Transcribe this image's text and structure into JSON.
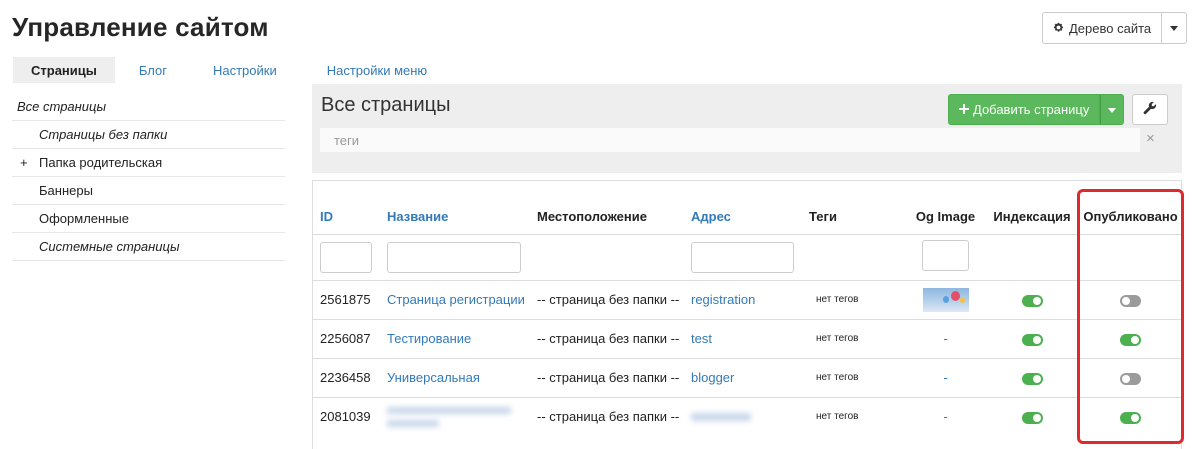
{
  "page": {
    "title": "Управление сайтом"
  },
  "header": {
    "site_tree_label": "Дерево сайта"
  },
  "tabs": [
    {
      "label": "Страницы",
      "active": true
    },
    {
      "label": "Блог"
    },
    {
      "label": "Настройки"
    },
    {
      "label": "Настройки меню"
    }
  ],
  "sidebar": {
    "items": [
      {
        "label": "Все страницы"
      },
      {
        "label": "Страницы без папки"
      },
      {
        "label": "Папка родительская",
        "expander": "+"
      },
      {
        "label": "Баннеры"
      },
      {
        "label": "Оформленные"
      },
      {
        "label": "Системные страницы"
      }
    ]
  },
  "main": {
    "title": "Все страницы",
    "add_label": "Добавить страницу",
    "tags_placeholder": "теги",
    "clear_symbol": "×"
  },
  "table": {
    "columns": {
      "id": "ID",
      "name": "Название",
      "location": "Местоположение",
      "address": "Адрес",
      "tags": "Теги",
      "og_image": "Og Image",
      "indexing": "Индексация",
      "published": "Опубликовано"
    },
    "rows": [
      {
        "id": "2561875",
        "name": "Страница регистрации",
        "location": "-- страница без папки --",
        "address": "registration",
        "tags": "нет тегов",
        "og": "image",
        "indexing": true,
        "published": false
      },
      {
        "id": "2256087",
        "name": "Тестирование",
        "location": "-- страница без папки --",
        "address": "test",
        "tags": "нет тегов",
        "og": "-",
        "indexing": true,
        "published": true
      },
      {
        "id": "2236458",
        "name": "Универсальная",
        "location": "-- страница без папки --",
        "address": "blogger",
        "tags": "нет тегов",
        "og": "-",
        "indexing": true,
        "published": false
      },
      {
        "id": "2081039",
        "name": "",
        "location": "-- страница без папки --",
        "address": "",
        "tags": "нет тегов",
        "og": "-",
        "indexing": true,
        "published": true
      }
    ]
  },
  "colors": {
    "link": "#337ab7",
    "add_button": "#5cb85c",
    "toggle_on": "#4caf50",
    "toggle_off": "#9b9b9b",
    "highlight": "#e0292d"
  }
}
